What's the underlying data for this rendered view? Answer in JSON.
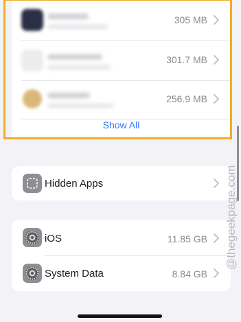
{
  "storage_apps": {
    "items": [
      {
        "size": "305 MB",
        "icon_color": "#2b2f45"
      },
      {
        "size": "301.7 MB",
        "icon_color": "#ececee"
      },
      {
        "size": "256.9 MB",
        "icon_color": "#d9b777"
      }
    ],
    "show_all_label": "Show All"
  },
  "hidden_apps": {
    "label": "Hidden Apps",
    "icon": "dashed-square-icon"
  },
  "system": {
    "items": [
      {
        "label": "iOS",
        "size": "11.85 GB",
        "icon": "gear-icon"
      },
      {
        "label": "System Data",
        "size": "8.84 GB",
        "icon": "gear-icon"
      }
    ]
  },
  "watermark": "@thegeekpage.com",
  "colors": {
    "accent": "#3478f6",
    "highlight": "#f0ad25",
    "background": "#f2f2f7"
  }
}
